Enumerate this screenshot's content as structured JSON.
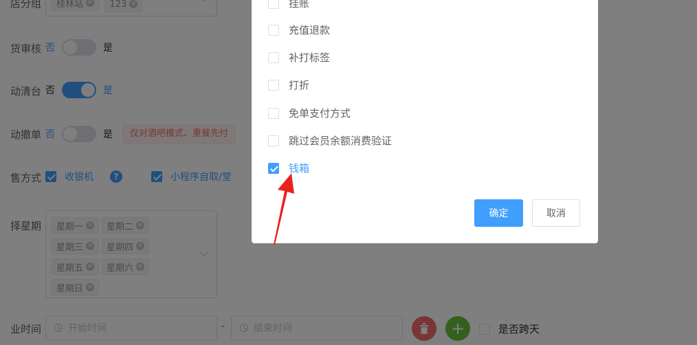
{
  "form": {
    "store_group": {
      "label": "店分组",
      "tags": [
        "桂林站",
        "123"
      ]
    },
    "delivery_review": {
      "label": "货审核",
      "no": "否",
      "yes": "是"
    },
    "auto_clear": {
      "label": "动清台",
      "no": "否",
      "yes": "是"
    },
    "auto_cancel": {
      "label": "动撤单",
      "no": "否",
      "yes": "是",
      "tip": "仅对酒吧模式、重餐先付"
    },
    "sale_method": {
      "label": "售方式",
      "opt1": "收银机",
      "help": "?",
      "opt2": "小程序自取/堂"
    },
    "weekdays": {
      "label": "择星期",
      "tags": [
        "星期一",
        "星期二",
        "星期三",
        "星期四",
        "星期五",
        "星期六",
        "星期日"
      ]
    },
    "business_time": {
      "label": "业时间",
      "start_placeholder": "开始时间",
      "separator": "-",
      "end_placeholder": "结束时间",
      "cross_day": "是否跨天"
    }
  },
  "dialog": {
    "items": [
      {
        "label": "挂账",
        "checked": false
      },
      {
        "label": "充值退款",
        "checked": false
      },
      {
        "label": "补打标签",
        "checked": false
      },
      {
        "label": "打折",
        "checked": false
      },
      {
        "label": "免单支付方式",
        "checked": false
      },
      {
        "label": "跳过会员余额消费验证",
        "checked": false
      },
      {
        "label": "钱箱",
        "checked": true
      }
    ],
    "confirm": "确定",
    "cancel": "取消"
  },
  "colors": {
    "primary": "#409eff",
    "danger": "#f56c6c",
    "success": "#67c23a",
    "annotation": "#e8231e"
  },
  "icons": {
    "tag_close": "close-icon",
    "clock": "clock-icon",
    "delete": "trash-icon",
    "add": "plus-icon",
    "help": "question-icon"
  }
}
